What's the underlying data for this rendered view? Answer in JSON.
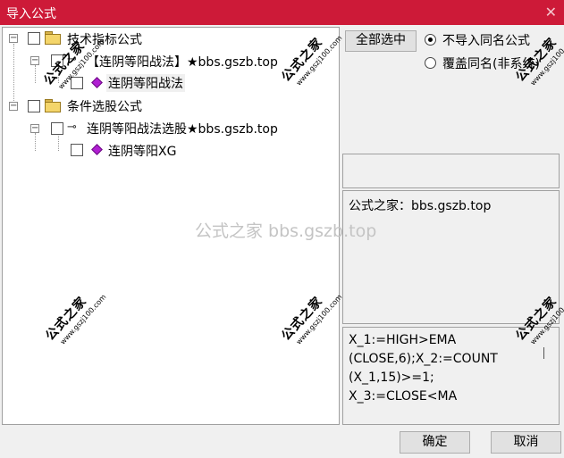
{
  "window": {
    "title": "导入公式",
    "close_icon": "close-icon"
  },
  "tree": {
    "nodes": [
      {
        "label": "技术指标公式",
        "icon": "folder-icon"
      },
      {
        "label": "【连阴等阳战法】★bbs.gszb.top",
        "icon": "key-icon"
      },
      {
        "label": "连阴等阳战法",
        "icon": "formula-gem-icon"
      },
      {
        "label": "条件选股公式",
        "icon": "folder-icon"
      },
      {
        "label": "连阴等阳战法选股★bbs.gszb.top",
        "icon": "key-icon"
      },
      {
        "label": "连阴等阳XG",
        "icon": "formula-gem-icon"
      }
    ],
    "expander_symbol": "−"
  },
  "controls": {
    "select_all_label": "全部选中",
    "radio_skip_label": "不导入同名公式",
    "radio_overwrite_label": "覆盖同名(非系统)",
    "selected_radio": "skip"
  },
  "info": {
    "text": "公式之家：bbs.gszb.top"
  },
  "code": {
    "text": "X_1:=HIGH>EMA\n(CLOSE,6);X_2:=COUNT\n(X_1,15)>=1;\nX_3:=CLOSE<MA"
  },
  "footer": {
    "ok_label": "确定",
    "cancel_label": "取消"
  },
  "watermark": {
    "center": "公式之家 bbs.gszb.top",
    "stamp_title": "公式之家",
    "stamp_url": "www.gszj100.com"
  },
  "colors": {
    "titlebar": "#cd1a38",
    "formula_gem": "#b01fd2",
    "folder": "#f4d56a"
  }
}
